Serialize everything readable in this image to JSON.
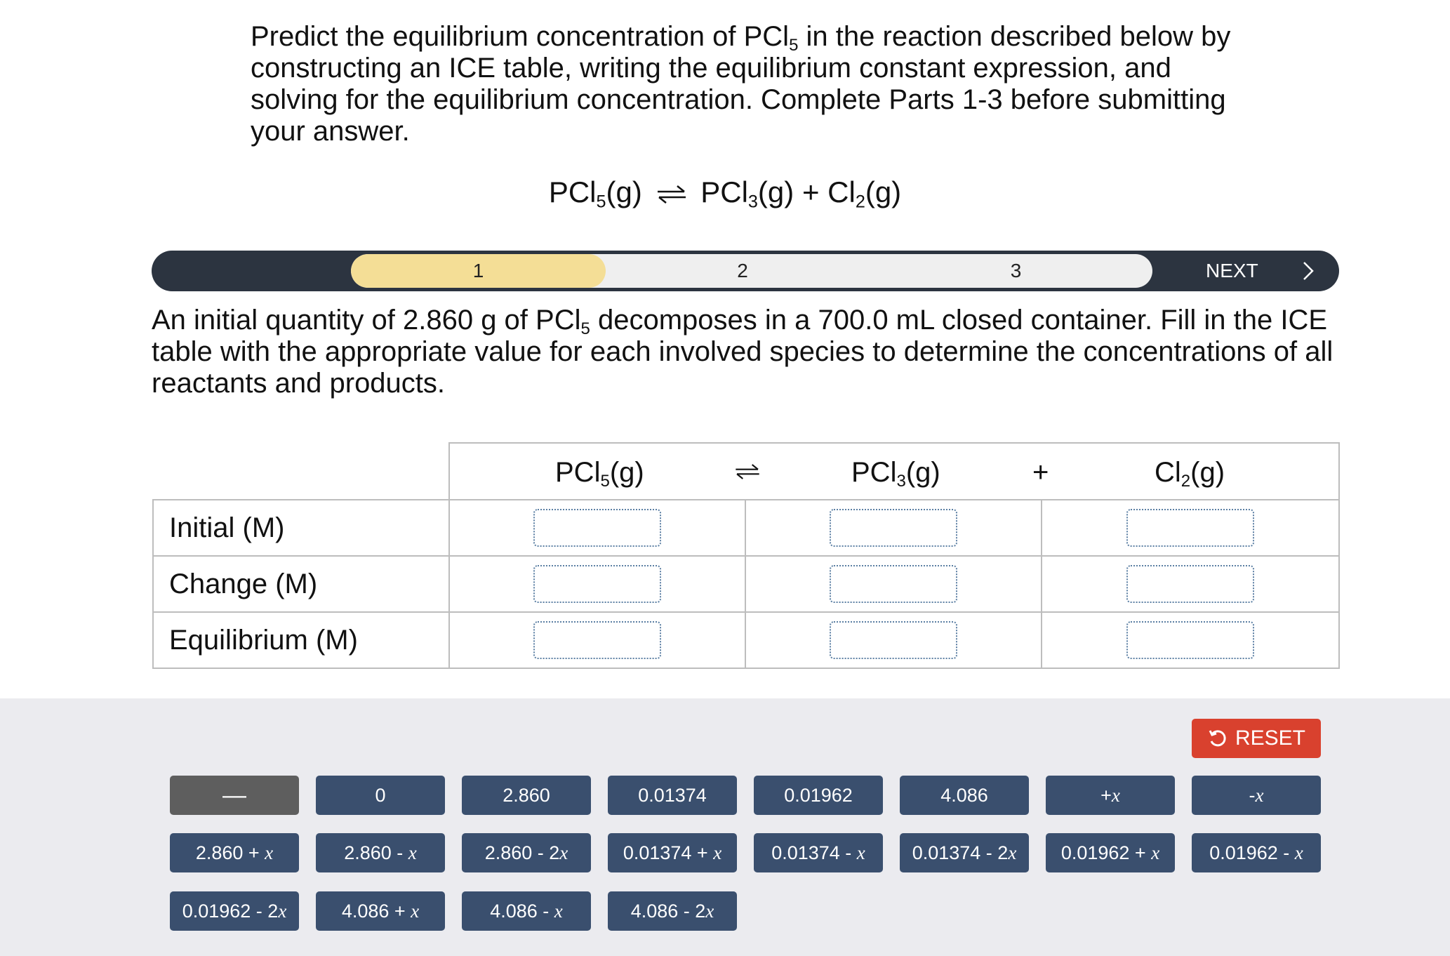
{
  "prompt": {
    "line1_a": "Predict the equilibrium concentration of PCl",
    "line1_sub": "5",
    "line1_b": " in the reaction described below by",
    "line2": "constructing an ICE table, writing the equilibrium constant expression, and",
    "line3": "solving for the equilibrium concentration. Complete Parts 1-3 before submitting",
    "line4": "your answer."
  },
  "reaction": {
    "reactant": "PCl",
    "reactant_sub": "5",
    "reactant_phase": "(g)",
    "product1": "PCl",
    "product1_sub": "3",
    "product1_phase": "(g)",
    "plus": "+",
    "product2": "Cl",
    "product2_sub": "2",
    "product2_phase": "(g)"
  },
  "progress": {
    "steps": [
      "1",
      "2",
      "3"
    ],
    "active_step": "1",
    "next_label": "NEXT",
    "active_color": "#f4de96",
    "bar_color": "#2c3440"
  },
  "description": {
    "line1_a": "An initial quantity of 2.860 g of PCl",
    "line1_sub": "5",
    "line1_b": " decomposes in a 700.0 mL closed container. Fill in the ICE",
    "line2": "table with the appropriate value for each involved species to determine the concentrations of all",
    "line3": "reactants and products."
  },
  "ice_table": {
    "header": {
      "s1": "PCl",
      "s1_sub": "5",
      "s1_phase": "(g)",
      "s2": "PCl",
      "s2_sub": "3",
      "s2_phase": "(g)",
      "s3": "Cl",
      "s3_sub": "2",
      "s3_phase": "(g)",
      "plus": "+"
    },
    "rows": [
      "Initial (M)",
      "Change (M)",
      "Equilibrium (M)"
    ]
  },
  "tray": {
    "reset_label": "RESET",
    "reset_color": "#d9412e",
    "tile_color": "#3a4f6e",
    "tiles": [
      {
        "num": "—",
        "var": ""
      },
      {
        "num": "0",
        "var": ""
      },
      {
        "num": "2.860",
        "var": ""
      },
      {
        "num": "0.01374",
        "var": ""
      },
      {
        "num": "0.01962",
        "var": ""
      },
      {
        "num": "4.086",
        "var": ""
      },
      {
        "num": "+",
        "var": "x"
      },
      {
        "num": "-",
        "var": "x"
      },
      {
        "num": "2.860 + ",
        "var": "x"
      },
      {
        "num": "2.860 - ",
        "var": "x"
      },
      {
        "num": "2.860 - 2",
        "var": "x"
      },
      {
        "num": "0.01374 + ",
        "var": "x"
      },
      {
        "num": "0.01374 - ",
        "var": "x"
      },
      {
        "num": "0.01374 - 2",
        "var": "x"
      },
      {
        "num": "0.01962 + ",
        "var": "x"
      },
      {
        "num": "0.01962 - ",
        "var": "x"
      },
      {
        "num": "0.01962 - 2",
        "var": "x"
      },
      {
        "num": "4.086 + ",
        "var": "x"
      },
      {
        "num": "4.086 - ",
        "var": "x"
      },
      {
        "num": "4.086 - 2",
        "var": "x"
      }
    ]
  }
}
